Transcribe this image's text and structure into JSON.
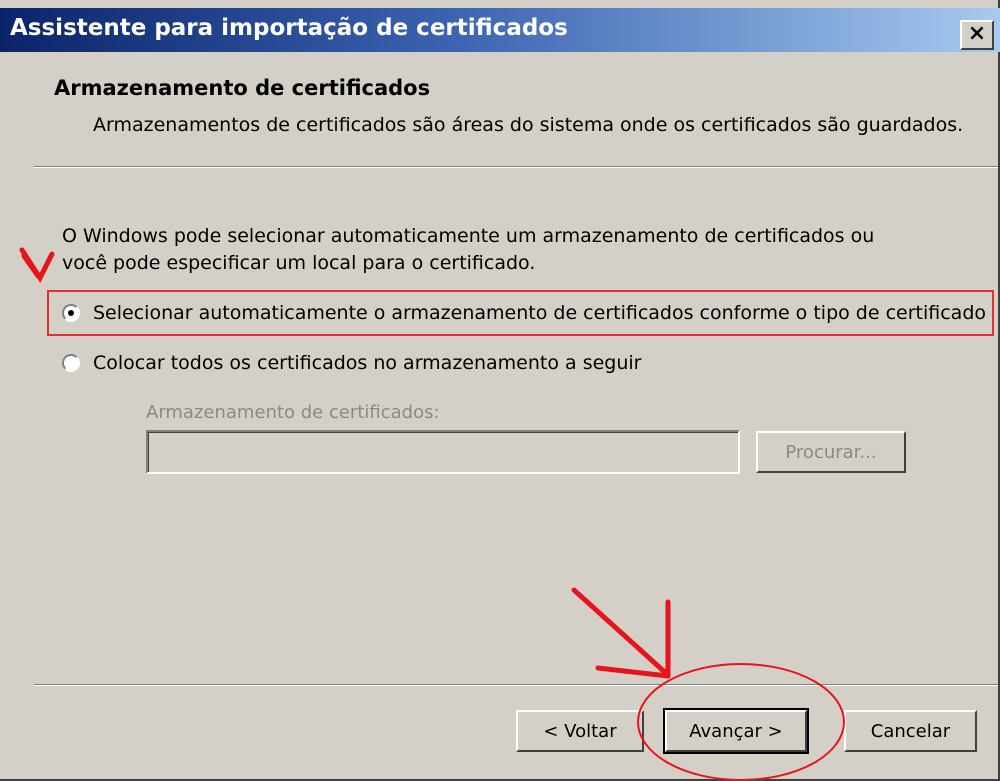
{
  "window": {
    "title": "Assistente para importação de certificados",
    "close_label": "×"
  },
  "header": {
    "title": "Armazenamento de certificados",
    "description": "Armazenamentos de certificados são áreas do sistema onde os certificados são guardados."
  },
  "body": {
    "intro_line1": "O Windows pode selecionar automaticamente um armazenamento de certificados ou",
    "intro_line2": "você pode especificar um local para o certificado.",
    "options": [
      {
        "label": "Selecionar automaticamente o armazenamento de certificados conforme o tipo de certificado",
        "selected": true
      },
      {
        "label": "Colocar todos os certificados no armazenamento a seguir",
        "selected": false
      }
    ],
    "store": {
      "label": "Armazenamento de certificados:",
      "value": "",
      "browse_label": "Procurar..."
    }
  },
  "footer": {
    "back_label": "< Voltar",
    "next_label": "Avançar >",
    "cancel_label": "Cancelar"
  },
  "annotations": {
    "color": "#e8141c",
    "description": "red hand-drawn arrows pointing to the first option and the Avançar button, with a red circle around Avançar"
  },
  "colors": {
    "face": "#d4d0c8",
    "title_start": "#0a246a",
    "title_end": "#a6caf0",
    "disabled_text": "#8a8a8a"
  }
}
